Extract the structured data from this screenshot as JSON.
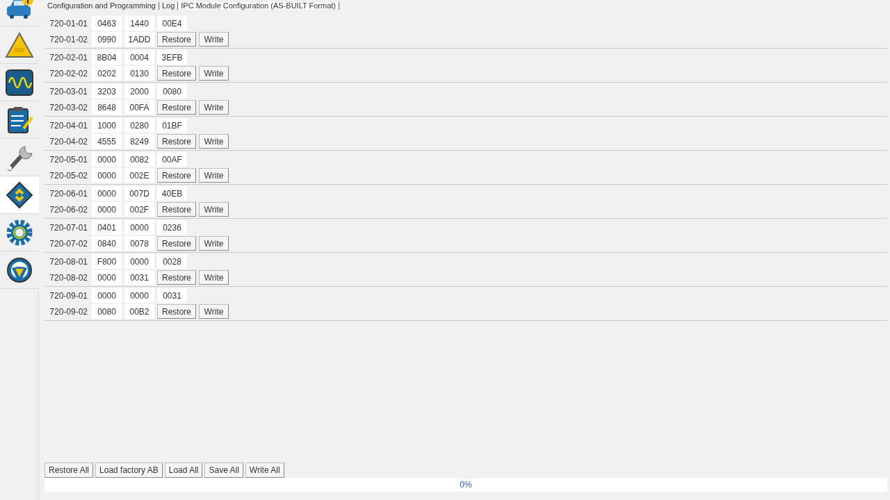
{
  "sidebar": {
    "items": [
      {
        "kind": "vehicle",
        "selected": false
      },
      {
        "kind": "dtc",
        "selected": false
      },
      {
        "kind": "scope",
        "selected": false
      },
      {
        "kind": "checklist",
        "selected": false
      },
      {
        "kind": "service",
        "selected": false
      },
      {
        "kind": "module",
        "selected": true
      },
      {
        "kind": "settings",
        "selected": false
      },
      {
        "kind": "help",
        "selected": false
      }
    ]
  },
  "tabs": [
    {
      "label": "Configuration and Programming",
      "selected": false
    },
    {
      "label": "Log",
      "selected": false
    },
    {
      "label": "IPC Module Configuration (AS-BUILT Format)",
      "selected": true
    }
  ],
  "groups": [
    {
      "rows": [
        {
          "address": "720-01-01",
          "values": [
            "0463",
            "1440",
            "00E4"
          ]
        },
        {
          "address": "720-01-02",
          "values": [
            "0990",
            "1ADD"
          ],
          "restore": "Restore",
          "write": "Write"
        }
      ]
    },
    {
      "rows": [
        {
          "address": "720-02-01",
          "values": [
            "8B04",
            "0004",
            "3EFB"
          ]
        },
        {
          "address": "720-02-02",
          "values": [
            "0202",
            "0130"
          ],
          "restore": "Restore",
          "write": "Write"
        }
      ]
    },
    {
      "rows": [
        {
          "address": "720-03-01",
          "values": [
            "3203",
            "2000",
            "0080"
          ]
        },
        {
          "address": "720-03-02",
          "values": [
            "8648",
            "00FA"
          ],
          "restore": "Restore",
          "write": "Write"
        }
      ]
    },
    {
      "rows": [
        {
          "address": "720-04-01",
          "values": [
            "1000",
            "0280",
            "01BF"
          ]
        },
        {
          "address": "720-04-02",
          "values": [
            "4555",
            "8249"
          ],
          "restore": "Restore",
          "write": "Write"
        }
      ]
    },
    {
      "rows": [
        {
          "address": "720-05-01",
          "values": [
            "0000",
            "0082",
            "00AF"
          ]
        },
        {
          "address": "720-05-02",
          "values": [
            "0000",
            "002E"
          ],
          "restore": "Restore",
          "write": "Write"
        }
      ]
    },
    {
      "rows": [
        {
          "address": "720-06-01",
          "values": [
            "0000",
            "007D",
            "40EB"
          ]
        },
        {
          "address": "720-06-02",
          "values": [
            "0000",
            "002F"
          ],
          "restore": "Restore",
          "write": "Write"
        }
      ]
    },
    {
      "rows": [
        {
          "address": "720-07-01",
          "values": [
            "0401",
            "0000",
            "0236"
          ]
        },
        {
          "address": "720-07-02",
          "values": [
            "0840",
            "0078"
          ],
          "restore": "Restore",
          "write": "Write"
        }
      ]
    },
    {
      "rows": [
        {
          "address": "720-08-01",
          "values": [
            "F800",
            "0000",
            "0028"
          ]
        },
        {
          "address": "720-08-02",
          "values": [
            "0000",
            "0031"
          ],
          "restore": "Restore",
          "write": "Write"
        }
      ]
    },
    {
      "rows": [
        {
          "address": "720-09-01",
          "values": [
            "0000",
            "0000",
            "0031"
          ]
        },
        {
          "address": "720-09-02",
          "values": [
            "0080",
            "00B2"
          ],
          "restore": "Restore",
          "write": "Write"
        }
      ]
    }
  ],
  "actions": [
    "Restore All",
    "Load factory AB",
    "Load All",
    "Save All",
    "Write All"
  ],
  "progress": {
    "level": 0,
    "reading": "0%"
  }
}
